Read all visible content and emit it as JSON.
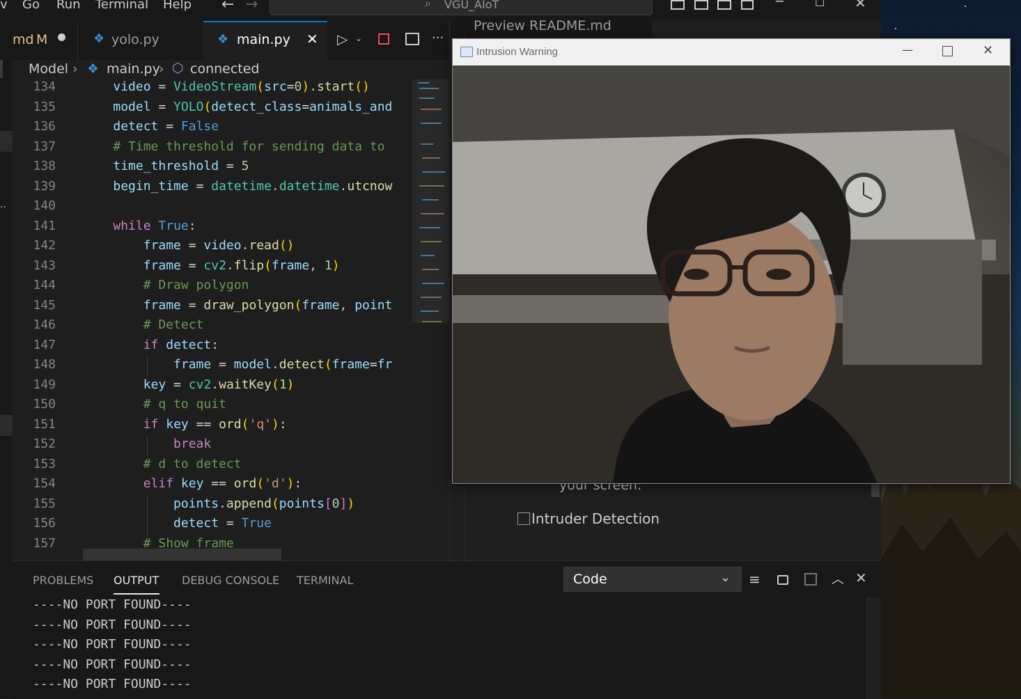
{
  "menubar": {
    "items": [
      "v",
      "Go",
      "Run",
      "Terminal",
      "Help"
    ],
    "search_text": "VGU_AIoT"
  },
  "tabs": [
    {
      "label": "md",
      "badge": "M"
    },
    {
      "label": "yolo.py"
    },
    {
      "label": "main.py",
      "active": true
    }
  ],
  "group2_tabs": {
    "label": "Preview README.md"
  },
  "breadcrumb": {
    "items": [
      "Model",
      "main.py",
      "connected"
    ]
  },
  "code": {
    "lines": [
      {
        "num": "134"
      },
      {
        "num": "135"
      },
      {
        "num": "136"
      },
      {
        "num": "137"
      },
      {
        "num": "138"
      },
      {
        "num": "139"
      },
      {
        "num": "140"
      },
      {
        "num": "141"
      },
      {
        "num": "142"
      },
      {
        "num": "143"
      },
      {
        "num": "144"
      },
      {
        "num": "145"
      },
      {
        "num": "146"
      },
      {
        "num": "147"
      },
      {
        "num": "148"
      },
      {
        "num": "149"
      },
      {
        "num": "150"
      },
      {
        "num": "151"
      },
      {
        "num": "152"
      },
      {
        "num": "153"
      },
      {
        "num": "154"
      },
      {
        "num": "155"
      },
      {
        "num": "156"
      },
      {
        "num": "157"
      }
    ]
  },
  "readme": {
    "text": "your screen:",
    "image_alt": "Intruder Detection"
  },
  "panel": {
    "tabs": [
      "PROBLEMS",
      "OUTPUT",
      "DEBUG CONSOLE",
      "TERMINAL"
    ],
    "active_tab": "OUTPUT",
    "dropdown_value": "Code",
    "output_lines": [
      "----NO PORT FOUND----",
      "----NO PORT FOUND----",
      "----NO PORT FOUND----",
      "----NO PORT FOUND----",
      "----NO PORT FOUND----"
    ]
  },
  "window": {
    "title": "Intrusion Warning"
  },
  "colors": {
    "accent": "#0078d4",
    "editor_bg": "#1e1e1e",
    "panel_bg": "#181818"
  }
}
